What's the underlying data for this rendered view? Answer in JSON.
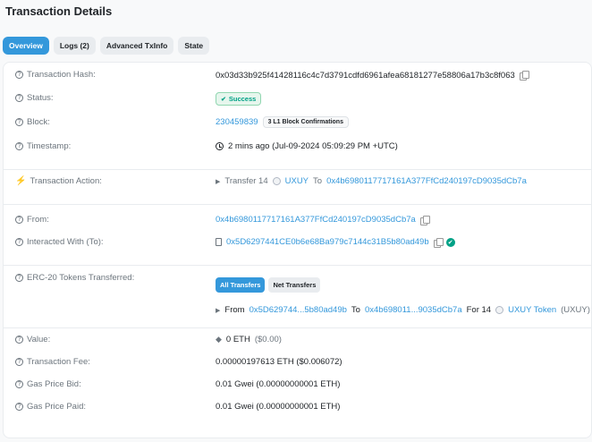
{
  "page": {
    "title": "Transaction Details"
  },
  "tabs": [
    {
      "label": "Overview",
      "active": true
    },
    {
      "label": "Logs (2)",
      "active": false
    },
    {
      "label": "Advanced TxInfo",
      "active": false
    },
    {
      "label": "State",
      "active": false
    }
  ],
  "tx": {
    "hash_label": "Transaction Hash:",
    "hash": "0x03d33b925f41428116c4c7d3791cdfd6961afea68181277e58806a17b3c8f063",
    "status_label": "Status:",
    "status": "Success",
    "block_label": "Block:",
    "block": "230459839",
    "block_confirmations": "3 L1 Block Confirmations",
    "timestamp_label": "Timestamp:",
    "timestamp": "2 mins ago (Jul-09-2024 05:09:29 PM +UTC)",
    "action_label": "Transaction Action:",
    "action_prefix": "Transfer 14",
    "action_token": "UXUY",
    "action_to_word": "To",
    "action_to": "0x4b6980117717161A377FfCd240197cD9035dCb7a",
    "from_label": "From:",
    "from": "0x4b6980117717161A377FfCd240197cD9035dCb7a",
    "interacted_label": "Interacted With (To):",
    "interacted": "0x5D6297441CE0b6e68Ba979c7144c31B5b80ad49b",
    "erc20_label": "ERC-20 Tokens Transferred:",
    "erc20_btn_all": "All Transfers",
    "erc20_btn_net": "Net Transfers",
    "transfer_from_word": "From",
    "transfer_from": "0x5D629744...5b80ad49b",
    "transfer_to_word": "To",
    "transfer_to": "0x4b698011...9035dCb7a",
    "transfer_for": "For 14",
    "transfer_token": "UXUY Token",
    "transfer_symbol": "(UXUY)",
    "value_label": "Value:",
    "value": "0 ETH",
    "value_usd": "($0.00)",
    "fee_label": "Transaction Fee:",
    "fee": "0.00000197613 ETH ($0.006072)",
    "gas_bid_label": "Gas Price Bid:",
    "gas_bid": "0.01 Gwei (0.00000000001 ETH)",
    "gas_paid_label": "Gas Price Paid:",
    "gas_paid": "0.01 Gwei (0.00000000001 ETH)"
  },
  "colors": {
    "accent": "#3498db",
    "success": "#00a186"
  }
}
